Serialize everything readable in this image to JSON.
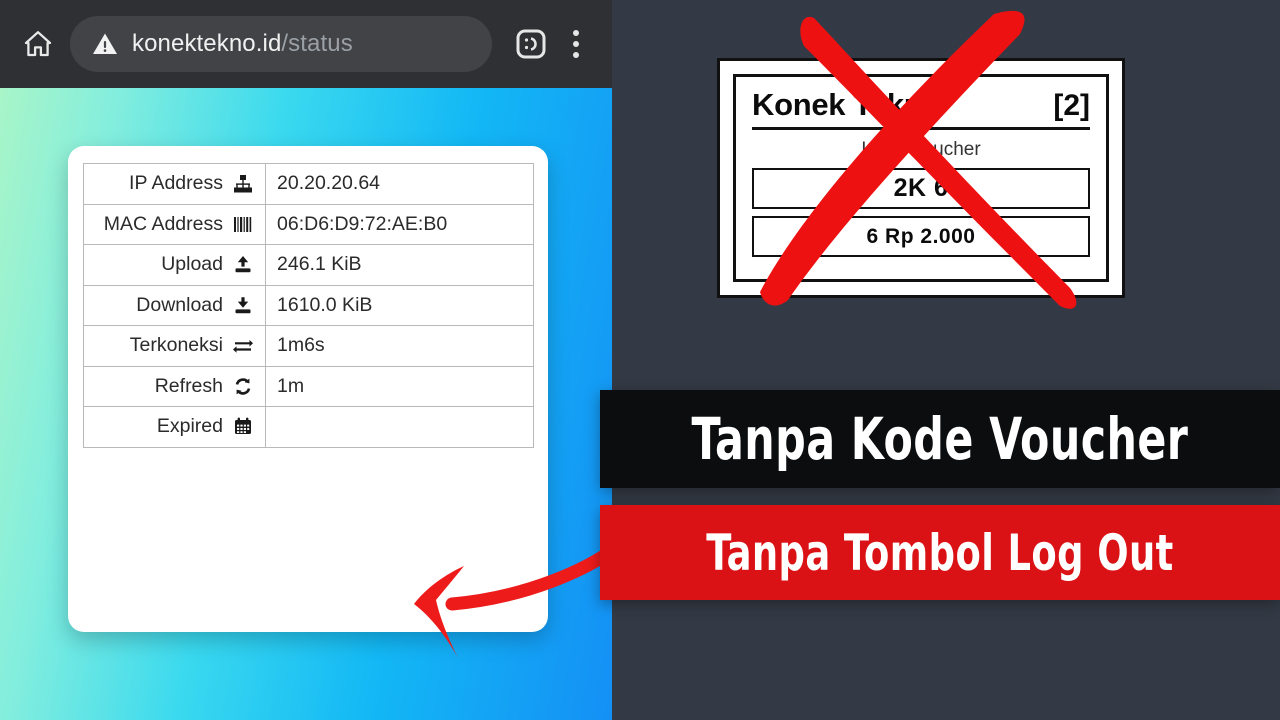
{
  "browser": {
    "home_icon": "home-icon",
    "security_icon": "warning-triangle-icon",
    "url_domain": "konektekno.id",
    "url_path": "/status",
    "tabs_icon": "tab-count-icon",
    "tab_count": ":D",
    "menu_icon": "overflow-menu-icon"
  },
  "status_page": {
    "rows": [
      {
        "label": "IP Address",
        "icon": "sitemap-icon",
        "value": "20.20.20.64"
      },
      {
        "label": "MAC Address",
        "icon": "barcode-icon",
        "value": "06:D6:D9:72:AE:B0"
      },
      {
        "label": "Upload",
        "icon": "upload-icon",
        "value": "246.1 KiB"
      },
      {
        "label": "Download",
        "icon": "download-icon",
        "value": "1610.0 KiB"
      },
      {
        "label": "Terkoneksi",
        "icon": "exchange-icon",
        "value": "1m6s"
      },
      {
        "label": "Refresh",
        "icon": "sync-icon",
        "value": "1m"
      },
      {
        "label": "Expired",
        "icon": "calendar-icon",
        "value": ""
      }
    ]
  },
  "voucher": {
    "brand": "Konek Tekno",
    "count": "[2]",
    "subtitle": "Kode Voucher",
    "code": "2K        6",
    "price": "6    Rp 2.000",
    "cross_icon": "red-cross-out-icon"
  },
  "banners": {
    "black_text": "Tanpa Kode Voucher",
    "red_text": "Tanpa Tombol Log Out"
  },
  "annotation": {
    "arrow_icon": "red-curved-arrow-icon"
  },
  "colors": {
    "toolbar": "#2f3033",
    "omnibox": "#414347",
    "panel_dark": "#343a45",
    "banner_black": "#0c0d0e",
    "banner_red": "#da1115",
    "accent_red": "#e81b1b",
    "gradient_from": "#a8f5c8",
    "gradient_to": "#1490f5"
  }
}
